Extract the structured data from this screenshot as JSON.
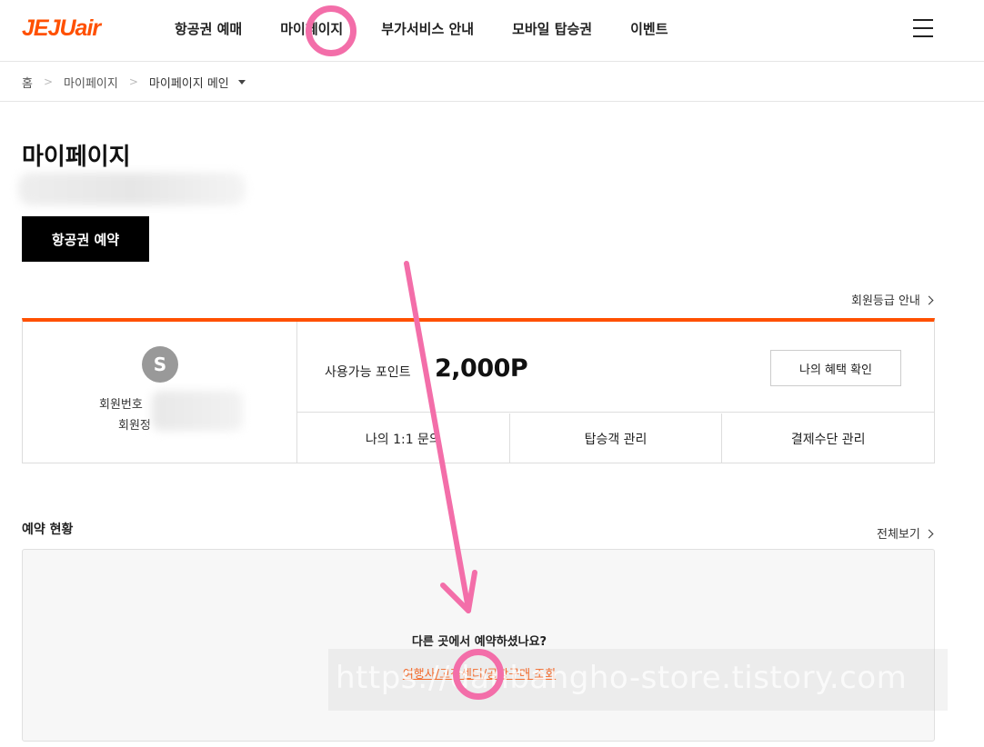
{
  "header": {
    "logo": "JEJUair",
    "nav": [
      "항공권 예매",
      "마이페이지",
      "부가서비스 안내",
      "모바일 탑승권",
      "이벤트"
    ]
  },
  "breadcrumb": {
    "home": "홈",
    "mypage": "마이페이지",
    "current": "마이페이지 메인"
  },
  "page": {
    "title": "마이페이지",
    "book_button": "항공권 예약",
    "grade_link": "회원등급 안내"
  },
  "member": {
    "avatar_initial": "S",
    "member_no_label": "회원번호",
    "member_name_label": "회원정",
    "points_label": "사용가능 포인트",
    "points_value": "2,000P",
    "benefit_button": "나의 혜택 확인",
    "actions": [
      "나의 1:1 문의",
      "탑승객 관리",
      "결제수단 관리"
    ]
  },
  "reservation": {
    "title": "예약 현황",
    "view_all": "전체보기",
    "question": "다른 곳에서 예약하셨나요?",
    "lookup_link": "여행사/고객센터/공항구매 조회"
  },
  "watermark": "https://danbangho-store.tistory.com",
  "annotation_color": "#f36ea9",
  "brand_color": "#ff5000"
}
